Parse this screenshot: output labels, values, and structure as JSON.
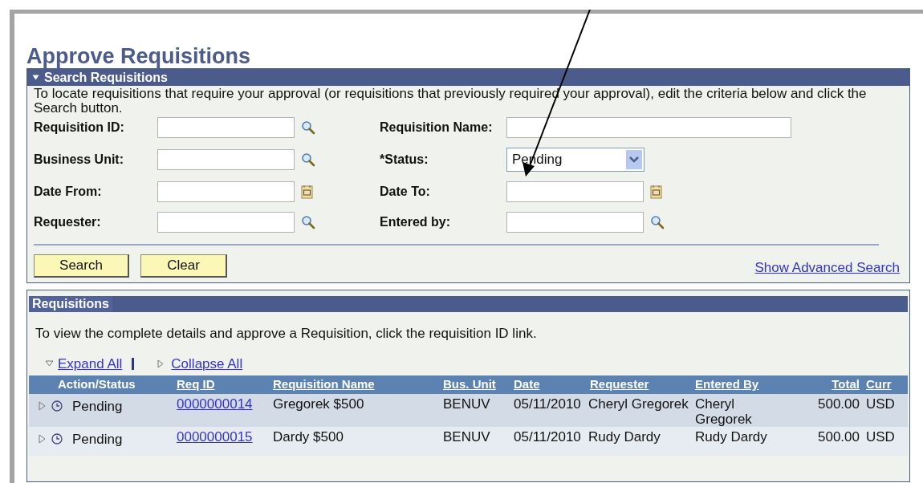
{
  "page": {
    "title": "Approve Requisitions"
  },
  "search_panel": {
    "title": "Search Requisitions",
    "expanded": true,
    "instructions": "To locate requisitions that require your approval (or requisitions that previously required your approval), edit the criteria below and click the Search button.",
    "fields": [
      {
        "label": "Requisition ID:",
        "kind": "lookup"
      },
      {
        "label": "Requisition Name:",
        "kind": "text"
      },
      {
        "label": "Business Unit:",
        "kind": "lookup"
      },
      {
        "label": "*Status:",
        "kind": "select",
        "value": "Pending"
      },
      {
        "label": "Date From:",
        "kind": "calendar"
      },
      {
        "label": "Date To:",
        "kind": "calendar"
      },
      {
        "label": "Requester:",
        "kind": "lookup"
      },
      {
        "label": "Entered by:",
        "kind": "lookup"
      }
    ],
    "buttons": [
      "Search",
      "Clear"
    ],
    "advanced_link": "Show Advanced Search"
  },
  "requisitions_panel": {
    "title": "Requisitions",
    "instructions": "To view the complete details and approve a Requisition, click the requisition ID link.",
    "expand_all": "Expand All",
    "collapse_all": "Collapse All",
    "columns": [
      {
        "label": "Action/Status",
        "link": false
      },
      {
        "label": "Req ID",
        "link": true
      },
      {
        "label": "Requisition Name",
        "link": true
      },
      {
        "label": "Bus. Unit",
        "link": true
      },
      {
        "label": "Date",
        "link": true
      },
      {
        "label": "Requester",
        "link": true
      },
      {
        "label": "Entered By",
        "link": true
      },
      {
        "label": "Total",
        "link": true
      },
      {
        "label": "Curr",
        "link": true
      }
    ],
    "rows": [
      {
        "expanded": false,
        "status": "Pending",
        "req_id": "0000000014",
        "name": "Gregorek $500",
        "bus_unit": "BENUV",
        "date": "05/11/2010",
        "requester": "Cheryl Gregorek",
        "entered_by": "Cheryl Gregorek",
        "total": "500.00",
        "currency": "USD"
      },
      {
        "expanded": false,
        "status": "Pending",
        "req_id": "0000000015",
        "name": "Dardy $500",
        "bus_unit": "BENUV",
        "date": "05/11/2010",
        "requester": "Rudy Dardy",
        "entered_by": "Rudy Dardy",
        "total": "500.00",
        "currency": "USD"
      }
    ]
  }
}
